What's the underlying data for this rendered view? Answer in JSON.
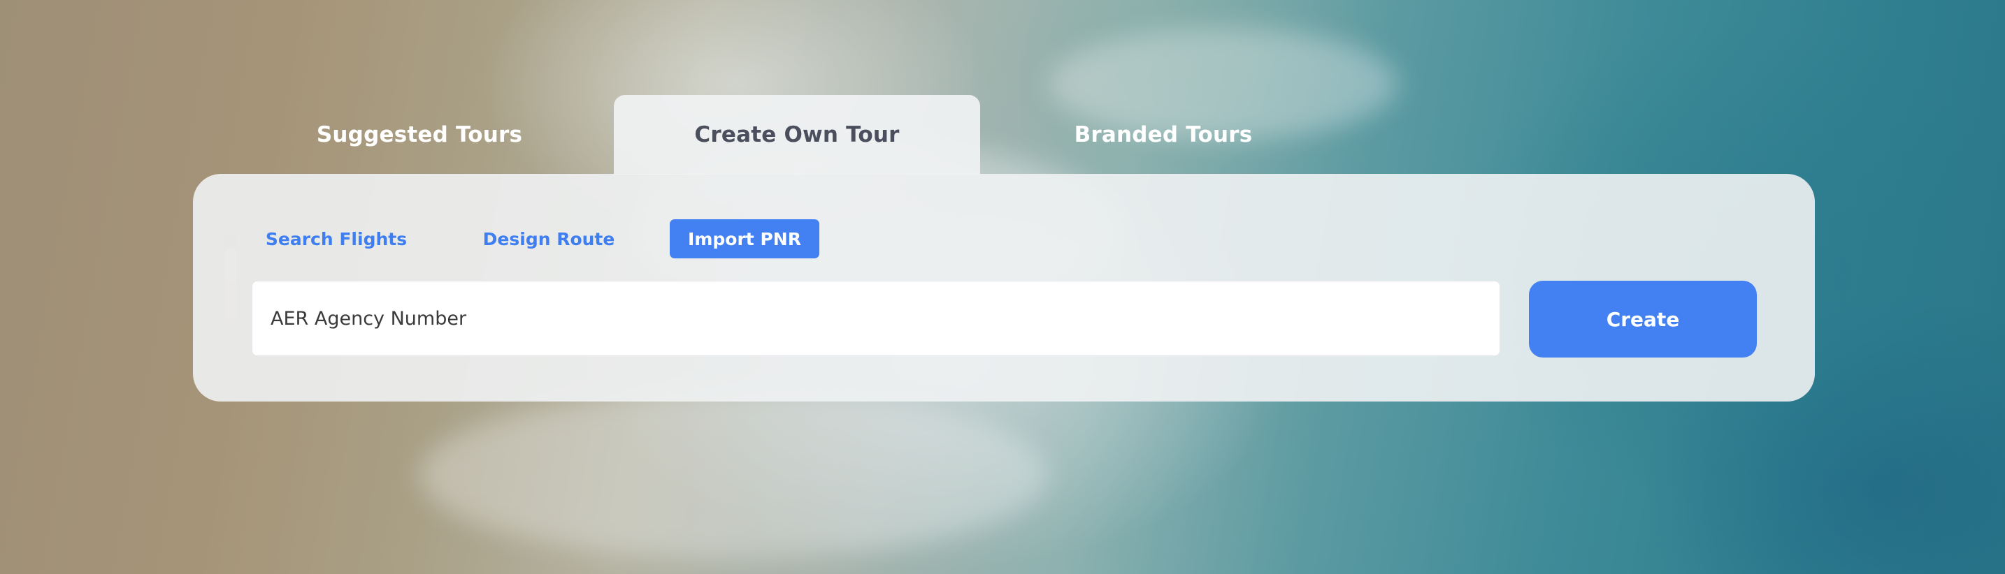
{
  "tabs": [
    {
      "label": "Suggested Tours",
      "active": false
    },
    {
      "label": "Create Own Tour",
      "active": true
    },
    {
      "label": "Branded Tours",
      "active": false
    }
  ],
  "subtabs": [
    {
      "label": "Search Flights",
      "active": false
    },
    {
      "label": "Design Route",
      "active": false
    },
    {
      "label": "Import PNR",
      "active": true
    }
  ],
  "form": {
    "agency_field_value": "AER Agency Number",
    "create_label": "Create"
  },
  "colors": {
    "accent": "#4381f2",
    "active_tab_text": "#4b4f5d"
  }
}
